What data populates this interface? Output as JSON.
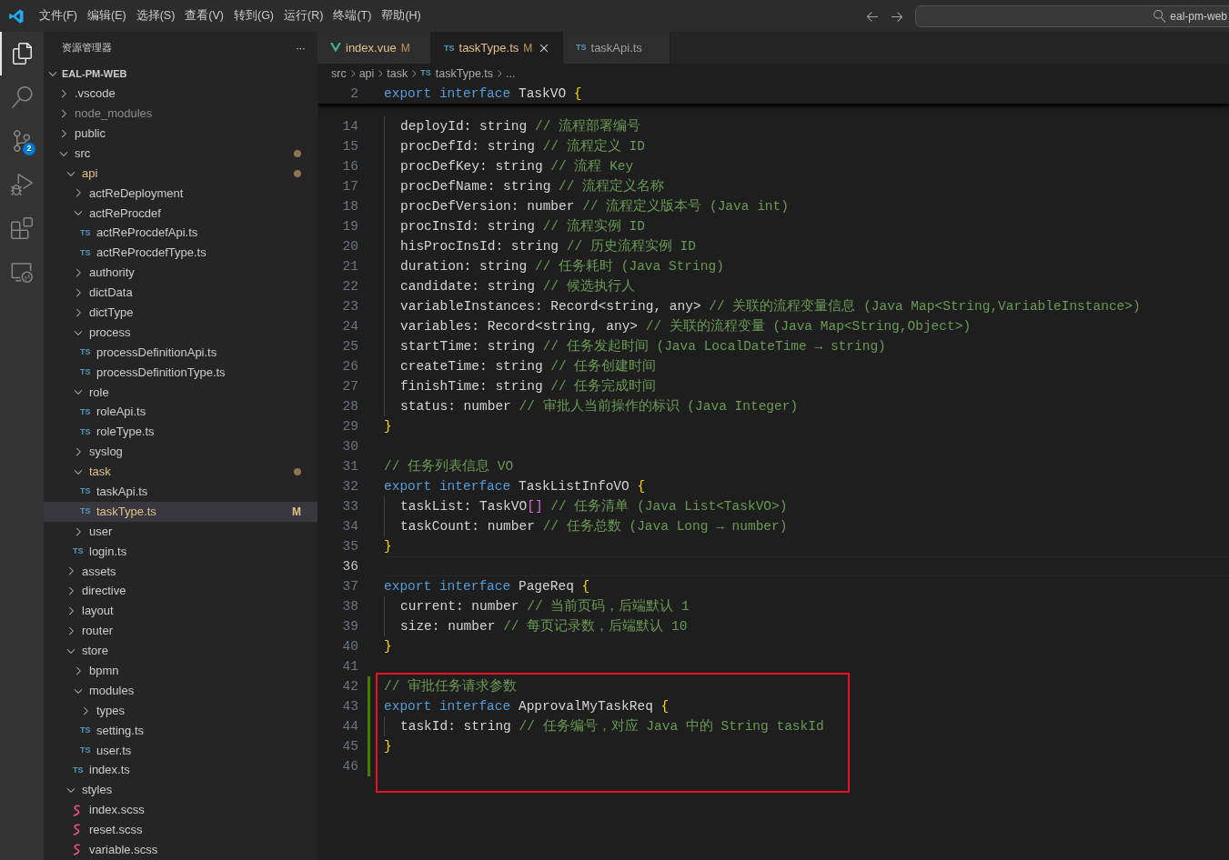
{
  "menu": [
    "文件(F)",
    "编辑(E)",
    "选择(S)",
    "查看(V)",
    "转到(G)",
    "运行(R)",
    "终端(T)",
    "帮助(H)"
  ],
  "search": {
    "value": "eal-pm-web"
  },
  "activity": [
    {
      "kind": "files",
      "selected": true
    },
    {
      "kind": "search",
      "selected": false
    },
    {
      "kind": "scm",
      "selected": false,
      "badge": "2"
    },
    {
      "kind": "debug",
      "selected": false
    },
    {
      "kind": "extensions",
      "selected": false
    },
    {
      "kind": "remote",
      "selected": false
    }
  ],
  "explorer": {
    "title": "资源管理器",
    "more": "···",
    "project": {
      "label": "EAL-PM-WEB",
      "expanded": true,
      "children": [
        {
          "label": ".vscode",
          "kind": "folder",
          "expanded": false,
          "modified": false,
          "dimmed": false,
          "dot": false,
          "selected": false
        },
        {
          "label": "node_modules",
          "kind": "folder",
          "expanded": false,
          "modified": false,
          "dimmed": true,
          "dot": false,
          "selected": false
        },
        {
          "label": "public",
          "kind": "folder",
          "expanded": false,
          "modified": false,
          "dimmed": false,
          "dot": false,
          "selected": false
        },
        {
          "label": "src",
          "kind": "folder",
          "expanded": true,
          "modified": false,
          "dimmed": false,
          "dot": true,
          "selected": false,
          "children": [
            {
              "label": "api",
              "kind": "folder",
              "expanded": true,
              "modified": true,
              "dimmed": false,
              "dot": true,
              "selected": false,
              "children": [
                {
                  "label": "actReDeployment",
                  "kind": "folder",
                  "expanded": false,
                  "modified": false,
                  "dimmed": false,
                  "dot": false,
                  "selected": false
                },
                {
                  "label": "actReProcdef",
                  "kind": "folder",
                  "expanded": true,
                  "modified": false,
                  "dimmed": false,
                  "dot": false,
                  "selected": false,
                  "children": [
                    {
                      "label": "actReProcdefApi.ts",
                      "kind": "ts",
                      "icon": "TS",
                      "modified": false,
                      "dimmed": false,
                      "dot": false,
                      "selected": false
                    },
                    {
                      "label": "actReProcdefType.ts",
                      "kind": "ts",
                      "icon": "TS",
                      "modified": false,
                      "dimmed": false,
                      "dot": false,
                      "selected": false
                    }
                  ]
                },
                {
                  "label": "authority",
                  "kind": "folder",
                  "expanded": false,
                  "modified": false,
                  "dimmed": false,
                  "dot": false,
                  "selected": false
                },
                {
                  "label": "dictData",
                  "kind": "folder",
                  "expanded": false,
                  "modified": false,
                  "dimmed": false,
                  "dot": false,
                  "selected": false
                },
                {
                  "label": "dictType",
                  "kind": "folder",
                  "expanded": false,
                  "modified": false,
                  "dimmed": false,
                  "dot": false,
                  "selected": false
                },
                {
                  "label": "process",
                  "kind": "folder",
                  "expanded": true,
                  "modified": false,
                  "dimmed": false,
                  "dot": false,
                  "selected": false,
                  "children": [
                    {
                      "label": "processDefinitionApi.ts",
                      "kind": "ts",
                      "icon": "TS",
                      "modified": false,
                      "dimmed": false,
                      "dot": false,
                      "selected": false
                    },
                    {
                      "label": "processDefinitionType.ts",
                      "kind": "ts",
                      "icon": "TS",
                      "modified": false,
                      "dimmed": false,
                      "dot": false,
                      "selected": false
                    }
                  ]
                },
                {
                  "label": "role",
                  "kind": "folder",
                  "expanded": true,
                  "modified": false,
                  "dimmed": false,
                  "dot": false,
                  "selected": false,
                  "children": [
                    {
                      "label": "roleApi.ts",
                      "kind": "ts",
                      "icon": "TS",
                      "modified": false,
                      "dimmed": false,
                      "dot": false,
                      "selected": false
                    },
                    {
                      "label": "roleType.ts",
                      "kind": "ts",
                      "icon": "TS",
                      "modified": false,
                      "dimmed": false,
                      "dot": false,
                      "selected": false
                    }
                  ]
                },
                {
                  "label": "syslog",
                  "kind": "folder",
                  "expanded": false,
                  "modified": false,
                  "dimmed": false,
                  "dot": false,
                  "selected": false
                },
                {
                  "label": "task",
                  "kind": "folder",
                  "expanded": true,
                  "modified": true,
                  "dimmed": false,
                  "dot": true,
                  "selected": false,
                  "children": [
                    {
                      "label": "taskApi.ts",
                      "kind": "ts",
                      "icon": "TS",
                      "modified": false,
                      "dimmed": false,
                      "dot": false,
                      "selected": false
                    },
                    {
                      "label": "taskType.ts",
                      "kind": "ts",
                      "icon": "TS",
                      "modified": true,
                      "dimmed": false,
                      "dot": false,
                      "selected": true,
                      "badge": "M"
                    }
                  ]
                },
                {
                  "label": "user",
                  "kind": "folder",
                  "expanded": false,
                  "modified": false,
                  "dimmed": false,
                  "dot": false,
                  "selected": false
                },
                {
                  "label": "login.ts",
                  "kind": "ts",
                  "icon": "TS",
                  "modified": false,
                  "dimmed": false,
                  "dot": false,
                  "selected": false
                }
              ]
            },
            {
              "label": "assets",
              "kind": "folder",
              "expanded": false,
              "modified": false,
              "dimmed": false,
              "dot": false,
              "selected": false
            },
            {
              "label": "directive",
              "kind": "folder",
              "expanded": false,
              "modified": false,
              "dimmed": false,
              "dot": false,
              "selected": false
            },
            {
              "label": "layout",
              "kind": "folder",
              "expanded": false,
              "modified": false,
              "dimmed": false,
              "dot": false,
              "selected": false
            },
            {
              "label": "router",
              "kind": "folder",
              "expanded": false,
              "modified": false,
              "dimmed": false,
              "dot": false,
              "selected": false
            },
            {
              "label": "store",
              "kind": "folder",
              "expanded": true,
              "modified": false,
              "dimmed": false,
              "dot": false,
              "selected": false,
              "children": [
                {
                  "label": "bpmn",
                  "kind": "folder",
                  "expanded": false,
                  "modified": false,
                  "dimmed": false,
                  "dot": false,
                  "selected": false
                },
                {
                  "label": "modules",
                  "kind": "folder",
                  "expanded": true,
                  "modified": false,
                  "dimmed": false,
                  "dot": false,
                  "selected": false,
                  "children": [
                    {
                      "label": "types",
                      "kind": "folder",
                      "expanded": false,
                      "modified": false,
                      "dimmed": false,
                      "dot": false,
                      "selected": false
                    },
                    {
                      "label": "setting.ts",
                      "kind": "ts",
                      "icon": "TS",
                      "modified": false,
                      "dimmed": false,
                      "dot": false,
                      "selected": false
                    },
                    {
                      "label": "user.ts",
                      "kind": "ts",
                      "icon": "TS",
                      "modified": false,
                      "dimmed": false,
                      "dot": false,
                      "selected": false
                    }
                  ]
                },
                {
                  "label": "index.ts",
                  "kind": "ts",
                  "icon": "TS",
                  "modified": false,
                  "dimmed": false,
                  "dot": false,
                  "selected": false
                }
              ]
            },
            {
              "label": "styles",
              "kind": "folder",
              "expanded": true,
              "modified": false,
              "dimmed": false,
              "dot": false,
              "selected": false,
              "children": [
                {
                  "label": "index.scss",
                  "kind": "scss",
                  "modified": false,
                  "dimmed": false,
                  "dot": false,
                  "selected": false
                },
                {
                  "label": "reset.scss",
                  "kind": "scss",
                  "modified": false,
                  "dimmed": false,
                  "dot": false,
                  "selected": false
                },
                {
                  "label": "variable.scss",
                  "kind": "scss",
                  "modified": false,
                  "dimmed": false,
                  "dot": false,
                  "selected": false
                }
              ]
            }
          ]
        }
      ]
    }
  },
  "tabs": [
    {
      "label": "index.vue",
      "kind": "vue",
      "badge": "M",
      "modified": true,
      "selected": false
    },
    {
      "label": "taskType.ts",
      "kind": "ts",
      "icon": "TS",
      "badge": "M",
      "modified": true,
      "selected": true
    },
    {
      "label": "taskApi.ts",
      "kind": "ts",
      "icon": "TS",
      "modified": false,
      "selected": false
    }
  ],
  "breadcrumbs": [
    {
      "label": "src"
    },
    {
      "label": "api"
    },
    {
      "label": "task"
    },
    {
      "label": "taskType.ts",
      "icon": "TS"
    },
    {
      "label": "..."
    }
  ],
  "sticky_line": {
    "n": "2",
    "tokens": [
      {
        "kind": "kw",
        "text": "export interface"
      },
      {
        "kind": "plain",
        "text": " TaskVO "
      },
      {
        "kind": "brace",
        "text": "{"
      }
    ]
  },
  "lines": [
    {
      "n": "14",
      "indented": true,
      "current": false,
      "added": false,
      "boxed": false,
      "tokens": [
        {
          "kind": "plain",
          "text": "deployId: string "
        },
        {
          "kind": "comment",
          "text": "// 流程部署编号"
        }
      ]
    },
    {
      "n": "15",
      "indented": true,
      "current": false,
      "added": false,
      "boxed": false,
      "tokens": [
        {
          "kind": "plain",
          "text": "procDefId: string "
        },
        {
          "kind": "comment",
          "text": "// 流程定义 ID"
        }
      ]
    },
    {
      "n": "16",
      "indented": true,
      "current": false,
      "added": false,
      "boxed": false,
      "tokens": [
        {
          "kind": "plain",
          "text": "procDefKey: string "
        },
        {
          "kind": "comment",
          "text": "// 流程 Key"
        }
      ]
    },
    {
      "n": "17",
      "indented": true,
      "current": false,
      "added": false,
      "boxed": false,
      "tokens": [
        {
          "kind": "plain",
          "text": "procDefName: string "
        },
        {
          "kind": "comment",
          "text": "// 流程定义名称"
        }
      ]
    },
    {
      "n": "18",
      "indented": true,
      "current": false,
      "added": false,
      "boxed": false,
      "tokens": [
        {
          "kind": "plain",
          "text": "procDefVersion: number "
        },
        {
          "kind": "comment",
          "text": "// 流程定义版本号 (Java int)"
        }
      ]
    },
    {
      "n": "19",
      "indented": true,
      "current": false,
      "added": false,
      "boxed": false,
      "tokens": [
        {
          "kind": "plain",
          "text": "procInsId: string "
        },
        {
          "kind": "comment",
          "text": "// 流程实例 ID"
        }
      ]
    },
    {
      "n": "20",
      "indented": true,
      "current": false,
      "added": false,
      "boxed": false,
      "tokens": [
        {
          "kind": "plain",
          "text": "hisProcInsId: string "
        },
        {
          "kind": "comment",
          "text": "// 历史流程实例 ID"
        }
      ]
    },
    {
      "n": "21",
      "indented": true,
      "current": false,
      "added": false,
      "boxed": false,
      "tokens": [
        {
          "kind": "plain",
          "text": "duration: string "
        },
        {
          "kind": "comment",
          "text": "// 任务耗时 (Java String)"
        }
      ]
    },
    {
      "n": "22",
      "indented": true,
      "current": false,
      "added": false,
      "boxed": false,
      "tokens": [
        {
          "kind": "plain",
          "text": "candidate: string "
        },
        {
          "kind": "comment",
          "text": "// 候选执行人"
        }
      ]
    },
    {
      "n": "23",
      "indented": true,
      "current": false,
      "added": false,
      "boxed": false,
      "tokens": [
        {
          "kind": "plain",
          "text": "variableInstances: Record<string, any> "
        },
        {
          "kind": "comment",
          "text": "// 关联的流程变量信息 (Java Map<String,VariableInstance>)"
        }
      ]
    },
    {
      "n": "24",
      "indented": true,
      "current": false,
      "added": false,
      "boxed": false,
      "tokens": [
        {
          "kind": "plain",
          "text": "variables: Record<string, any> "
        },
        {
          "kind": "comment",
          "text": "// 关联的流程变量 (Java Map<String,Object>)"
        }
      ]
    },
    {
      "n": "25",
      "indented": true,
      "current": false,
      "added": false,
      "boxed": false,
      "tokens": [
        {
          "kind": "plain",
          "text": "startTime: string "
        },
        {
          "kind": "comment",
          "text": "// 任务发起时间 (Java LocalDateTime → string)"
        }
      ]
    },
    {
      "n": "26",
      "indented": true,
      "current": false,
      "added": false,
      "boxed": false,
      "tokens": [
        {
          "kind": "plain",
          "text": "createTime: string "
        },
        {
          "kind": "comment",
          "text": "// 任务创建时间"
        }
      ]
    },
    {
      "n": "27",
      "indented": true,
      "current": false,
      "added": false,
      "boxed": false,
      "tokens": [
        {
          "kind": "plain",
          "text": "finishTime: string "
        },
        {
          "kind": "comment",
          "text": "// 任务完成时间"
        }
      ]
    },
    {
      "n": "28",
      "indented": true,
      "current": false,
      "added": false,
      "boxed": false,
      "tokens": [
        {
          "kind": "plain",
          "text": "status: number "
        },
        {
          "kind": "comment",
          "text": "// 审批人当前操作的标识 (Java Integer)"
        }
      ]
    },
    {
      "n": "29",
      "indented": false,
      "current": false,
      "added": false,
      "boxed": false,
      "tokens": [
        {
          "kind": "brace",
          "text": "}"
        }
      ]
    },
    {
      "n": "30",
      "current": false,
      "added": false,
      "boxed": false
    },
    {
      "n": "31",
      "indented": false,
      "current": false,
      "added": false,
      "boxed": false,
      "tokens": [
        {
          "kind": "comment",
          "text": "// 任务列表信息 VO"
        }
      ]
    },
    {
      "n": "32",
      "indented": false,
      "current": false,
      "added": false,
      "boxed": false,
      "tokens": [
        {
          "kind": "kw",
          "text": "export interface"
        },
        {
          "kind": "plain",
          "text": " TaskListInfoVO "
        },
        {
          "kind": "brace",
          "text": "{"
        }
      ]
    },
    {
      "n": "33",
      "indented": true,
      "current": false,
      "added": false,
      "boxed": false,
      "tokens": [
        {
          "kind": "plain",
          "text": "taskList: TaskVO"
        },
        {
          "kind": "bracket",
          "text": "[] "
        },
        {
          "kind": "comment",
          "text": "// 任务清单 (Java List<TaskVO>)"
        }
      ]
    },
    {
      "n": "34",
      "indented": true,
      "current": false,
      "added": false,
      "boxed": false,
      "tokens": [
        {
          "kind": "plain",
          "text": "taskCount: number "
        },
        {
          "kind": "comment",
          "text": "// 任务总数 (Java Long → number)"
        }
      ]
    },
    {
      "n": "35",
      "indented": false,
      "current": false,
      "added": false,
      "boxed": false,
      "tokens": [
        {
          "kind": "brace",
          "text": "}"
        }
      ]
    },
    {
      "n": "36",
      "current": true,
      "added": false,
      "boxed": false
    },
    {
      "n": "37",
      "indented": false,
      "current": false,
      "added": false,
      "boxed": false,
      "tokens": [
        {
          "kind": "kw",
          "text": "export interface"
        },
        {
          "kind": "plain",
          "text": " PageReq "
        },
        {
          "kind": "brace",
          "text": "{"
        }
      ]
    },
    {
      "n": "38",
      "indented": true,
      "current": false,
      "added": false,
      "boxed": false,
      "tokens": [
        {
          "kind": "plain",
          "text": "current: number "
        },
        {
          "kind": "comment",
          "text": "// 当前页码，后端默认 1"
        }
      ]
    },
    {
      "n": "39",
      "indented": true,
      "current": false,
      "added": false,
      "boxed": false,
      "tokens": [
        {
          "kind": "plain",
          "text": "size: number "
        },
        {
          "kind": "comment",
          "text": "// 每页记录数，后端默认 10"
        }
      ]
    },
    {
      "n": "40",
      "indented": false,
      "current": false,
      "added": false,
      "boxed": false,
      "tokens": [
        {
          "kind": "brace",
          "text": "}"
        }
      ]
    },
    {
      "n": "41",
      "current": false,
      "added": false,
      "boxed": false
    },
    {
      "n": "42",
      "indented": false,
      "current": false,
      "added": true,
      "boxed": true,
      "tokens": [
        {
          "kind": "comment",
          "text": "// 审批任务请求参数"
        }
      ]
    },
    {
      "n": "43",
      "indented": false,
      "current": false,
      "added": true,
      "boxed": true,
      "tokens": [
        {
          "kind": "kw",
          "text": "export interface"
        },
        {
          "kind": "plain",
          "text": " ApprovalMyTaskReq "
        },
        {
          "kind": "brace",
          "text": "{"
        }
      ]
    },
    {
      "n": "44",
      "indented": true,
      "current": false,
      "added": true,
      "boxed": true,
      "tokens": [
        {
          "kind": "plain",
          "text": "taskId: string "
        },
        {
          "kind": "comment",
          "text": "// 任务编号，对应 Java 中的 String taskId"
        }
      ]
    },
    {
      "n": "45",
      "indented": false,
      "current": false,
      "added": true,
      "boxed": true,
      "tokens": [
        {
          "kind": "brace",
          "text": "}"
        }
      ]
    },
    {
      "n": "46",
      "current": false,
      "added": true,
      "boxed": true
    }
  ]
}
